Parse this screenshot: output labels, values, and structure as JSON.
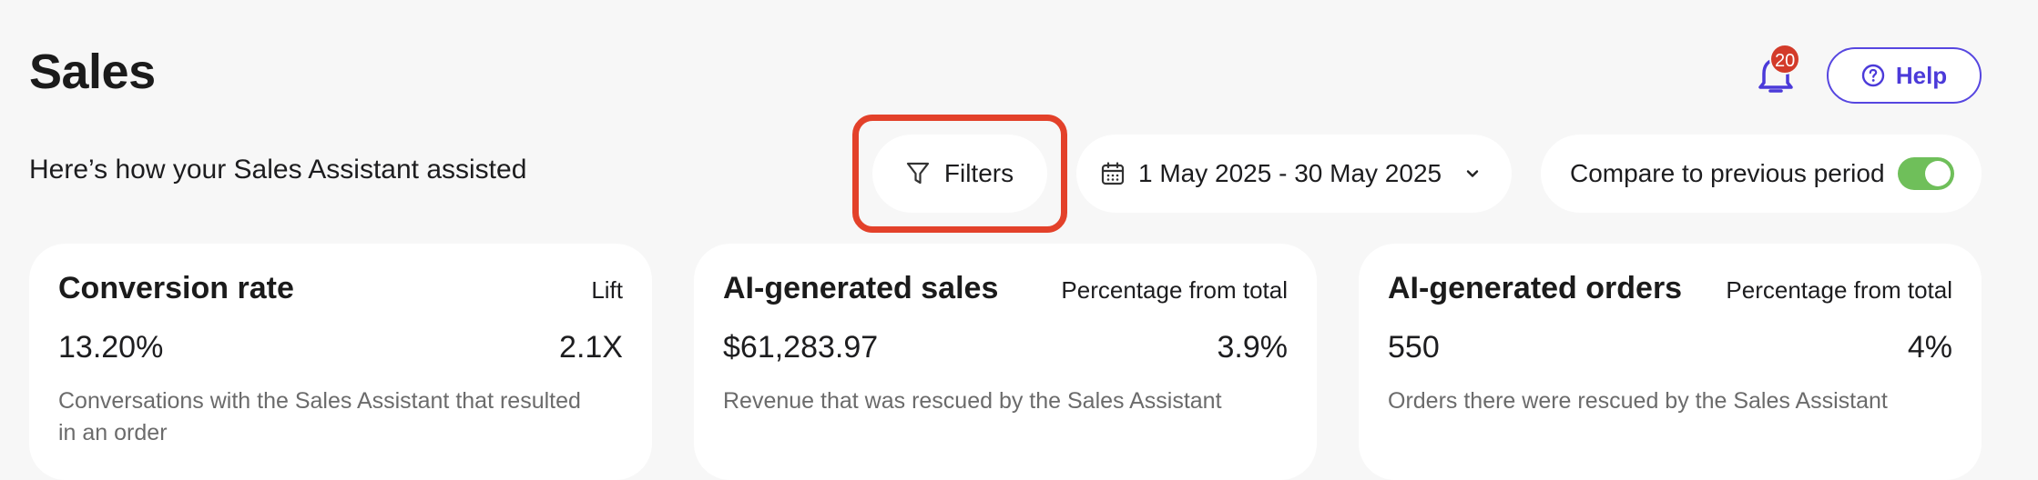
{
  "header": {
    "title": "Sales",
    "notifications_count": "20",
    "help_label": "Help"
  },
  "toolbar": {
    "subtitle": "Here’s how your Sales Assistant assisted",
    "filters_label": "Filters",
    "date_range": "1 May 2025 - 30 May 2025",
    "compare_label": "Compare to previous period",
    "compare_enabled": true
  },
  "cards": [
    {
      "title": "Conversion rate",
      "side_label": "Lift",
      "value": "13.20%",
      "side_value": "2.1X",
      "description": "Conversations with the Sales Assistant that resulted in an order"
    },
    {
      "title": "AI-generated sales",
      "side_label": "Percentage from total",
      "value": "$61,283.97",
      "side_value": "3.9%",
      "description": "Revenue that was rescued by the Sales Assistant"
    },
    {
      "title": "AI-generated orders",
      "side_label": "Percentage from total",
      "value": "550",
      "side_value": "4%",
      "description": "Orders there were rescued by the Sales Assistant"
    }
  ],
  "colors": {
    "accent": "#5646e0",
    "badge": "#d33b2a",
    "highlight": "#e3412a",
    "toggle_on": "#6fbf5a"
  }
}
